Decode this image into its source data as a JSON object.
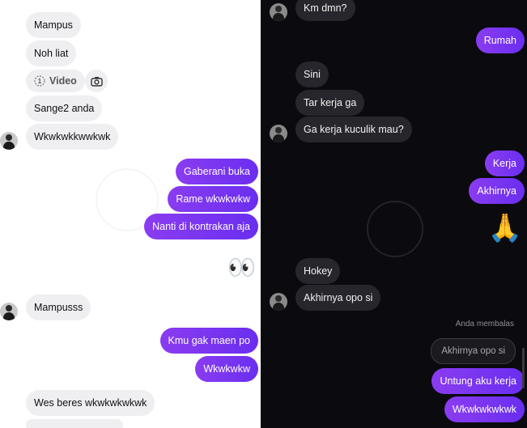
{
  "left_chat": {
    "messages": [
      {
        "text": "Mampus"
      },
      {
        "text": "Noh liat"
      },
      {
        "text": "Sange2 anda"
      },
      {
        "text": "Wkwkwkkwwkwk"
      },
      {
        "text": "Gaberani buka"
      },
      {
        "text": "Rame wkwkwkw"
      },
      {
        "text": "Nanti di kontrakan aja"
      },
      {
        "text": "Mampusss"
      },
      {
        "text": "Kmu gak maen po"
      },
      {
        "text": "Wkwkwkw"
      },
      {
        "text": "Wes beres wkwkwkwkwk"
      }
    ],
    "video_label": "Video",
    "video_count": "1",
    "eyes_emoji": "👀"
  },
  "right_chat": {
    "messages": [
      {
        "text": "Km dmn?"
      },
      {
        "text": "Rumah"
      },
      {
        "text": "Sini"
      },
      {
        "text": "Tar kerja ga"
      },
      {
        "text": "Ga kerja kuculik mau?"
      },
      {
        "text": "Kerja"
      },
      {
        "text": "Akhirnya"
      },
      {
        "text": "Hokey"
      },
      {
        "text": "Akhirnya opo si"
      },
      {
        "text": "Untung aku kerja"
      },
      {
        "text": "Wkwkwkwkwk"
      }
    ],
    "reply_label": "Anda membalas",
    "reply_quote": "Akhirnya opo si",
    "praying_emoji": "🙏"
  },
  "colors": {
    "outgoing": "#7b35f0",
    "incoming_light": "#efeff2",
    "incoming_dark": "#26262c",
    "dark_bg": "#0b0b0f"
  }
}
